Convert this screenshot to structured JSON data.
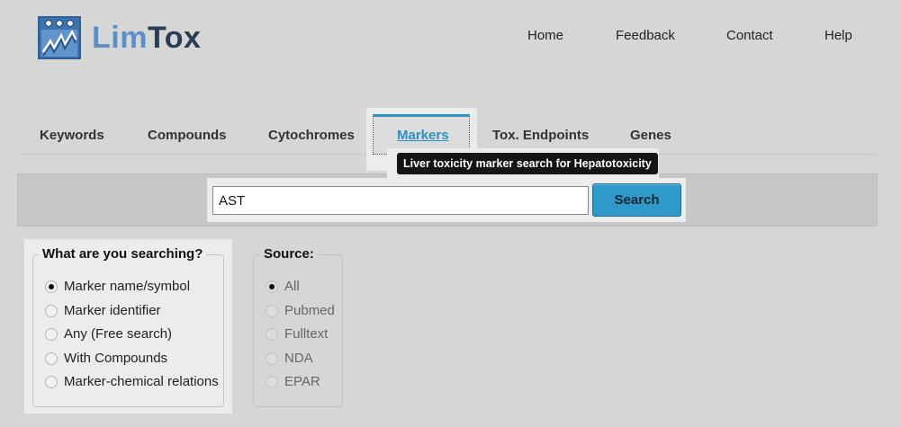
{
  "brand": {
    "part1": "Lim",
    "part2": "Tox"
  },
  "nav": {
    "home": "Home",
    "feedback": "Feedback",
    "contact": "Contact",
    "help": "Help"
  },
  "tabs": {
    "keywords": "Keywords",
    "compounds": "Compounds",
    "cytochromes": "Cytochromes",
    "markers": "Markers",
    "endpoints": "Tox. Endpoints",
    "genes": "Genes",
    "active": "Markers"
  },
  "tooltip": "Liver toxicity marker search for Hepatotoxicity",
  "search": {
    "value": "AST",
    "button": "Search"
  },
  "search_type": {
    "legend": "What are you searching?",
    "options": [
      "Marker name/symbol",
      "Marker identifier",
      "Any (Free search)",
      "With Compounds",
      "Marker-chemical relations"
    ],
    "selected": "Marker name/symbol"
  },
  "source": {
    "legend": "Source:",
    "options": [
      "All",
      "Pubmed",
      "Fulltext",
      "NDA",
      "EPAR"
    ],
    "selected": "All"
  }
}
